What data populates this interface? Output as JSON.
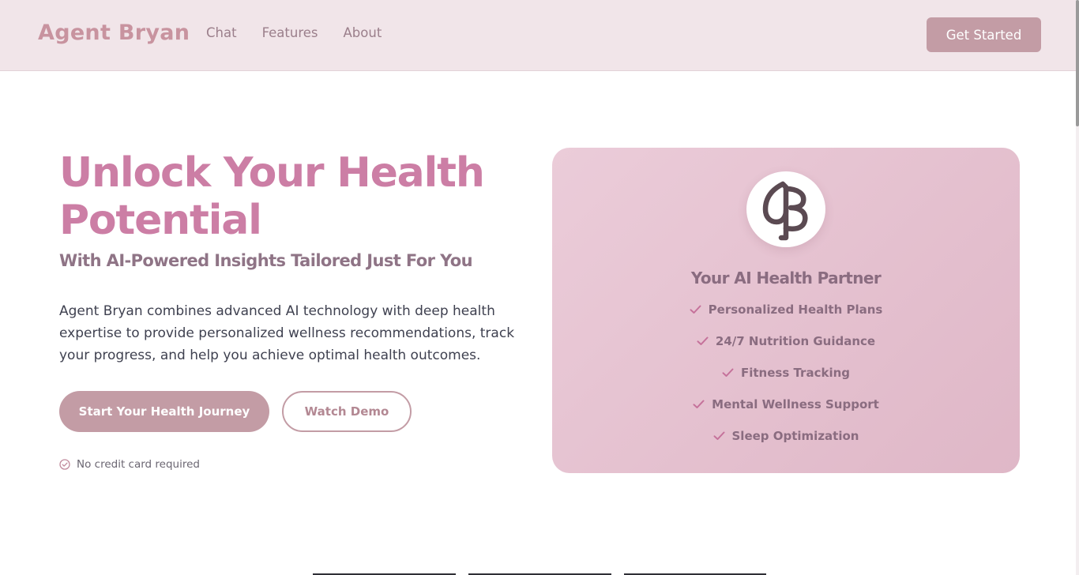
{
  "header": {
    "brand": "Agent Bryan",
    "nav": [
      "Chat",
      "Features",
      "About"
    ],
    "cta": "Get Started"
  },
  "hero": {
    "title": "Unlock Your Health Potential",
    "subtitle": "With AI-Powered Insights Tailored Just For You",
    "description": "Agent Bryan combines advanced AI technology with deep health expertise to provide personalized wellness recommendations, track your progress, and help you achieve optimal health outcomes.",
    "primary_button": "Start Your Health Journey",
    "secondary_button": "Watch Demo",
    "note": "No credit card required"
  },
  "card": {
    "title": "Your AI Health Partner",
    "features": [
      "Personalized Health Plans",
      "24/7 Nutrition Guidance",
      "Fitness Tracking",
      "Mental Wellness Support",
      "Sleep Optimization"
    ]
  },
  "icons": {
    "logo": "bryan-logo-icon",
    "check": "check-icon",
    "note": "check-circle-icon"
  },
  "colors": {
    "accent": "#cc7ea5",
    "button": "#c39ca5",
    "header_bg": "#f1e5e9",
    "card_bg": "#e6c4d2"
  }
}
